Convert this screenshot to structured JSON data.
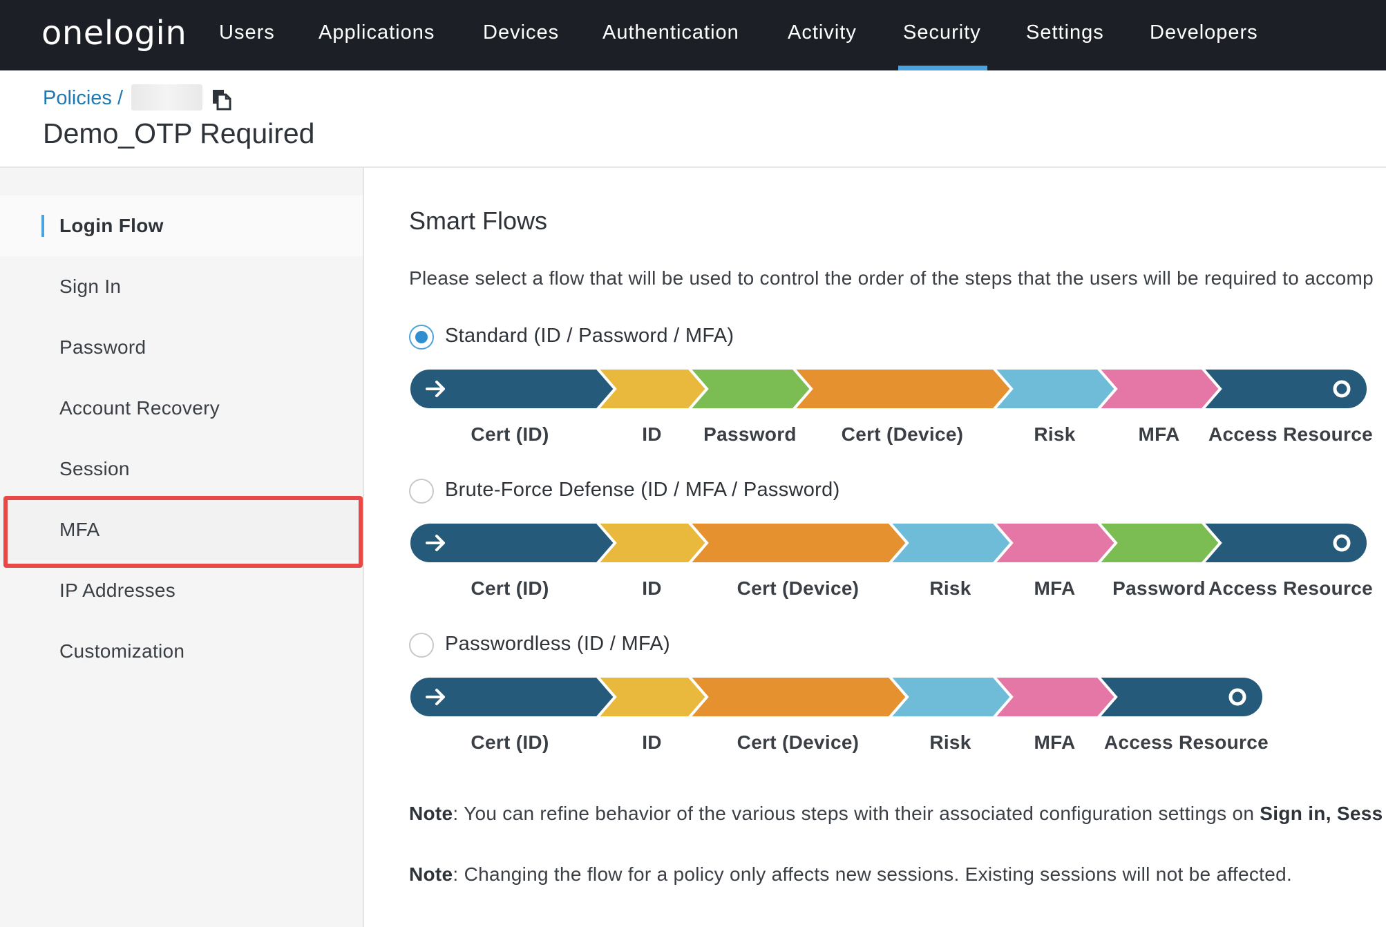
{
  "nav": {
    "logo": "onelogin",
    "items": [
      {
        "label": "Users"
      },
      {
        "label": "Applications"
      },
      {
        "label": "Devices"
      },
      {
        "label": "Authentication"
      },
      {
        "label": "Activity"
      },
      {
        "label": "Security",
        "active": true
      },
      {
        "label": "Settings"
      },
      {
        "label": "Developers"
      }
    ]
  },
  "header": {
    "breadcrumb_root": "Policies /",
    "title": "Demo_OTP Required"
  },
  "sidebar": {
    "items": [
      {
        "label": "Login Flow",
        "active": true
      },
      {
        "label": "Sign In"
      },
      {
        "label": "Password"
      },
      {
        "label": "Account Recovery"
      },
      {
        "label": "Session"
      },
      {
        "label": "MFA",
        "highlighted": true
      },
      {
        "label": "IP Addresses"
      },
      {
        "label": "Customization"
      }
    ]
  },
  "main": {
    "title": "Smart Flows",
    "description": "Please select a flow that will be used to control the order of the steps that the users will be required to accomp",
    "flows": [
      {
        "label": "Standard (ID / Password / MFA)",
        "selected": true,
        "steps": [
          "Cert (ID)",
          "ID",
          "Password",
          "Cert (Device)",
          "Risk",
          "MFA",
          "Access Resource"
        ]
      },
      {
        "label": "Brute-Force Defense (ID / MFA / Password)",
        "selected": false,
        "steps": [
          "Cert (ID)",
          "ID",
          "Cert (Device)",
          "Risk",
          "MFA",
          "Password",
          "Access Resource"
        ]
      },
      {
        "label": "Passwordless (ID / MFA)",
        "selected": false,
        "steps": [
          "Cert (ID)",
          "ID",
          "Cert (Device)",
          "Risk",
          "MFA",
          "Access Resource"
        ]
      }
    ],
    "note1_label": "Note",
    "note1_text": ": You can refine behavior of the various steps with their associated configuration settings on ",
    "note1_bold": "Sign in, Sess",
    "note2_label": "Note",
    "note2_text": ": Changing the flow for a policy only affects new sessions. Existing sessions will not be affected."
  },
  "colors": {
    "cert_id": "#265a7a",
    "id": "#e8b93c",
    "password": "#7bbd53",
    "cert_device": "#e5912f",
    "risk": "#6fbcd9",
    "mfa": "#e577a6",
    "access": "#265a7a",
    "accent": "#4aa3df",
    "highlight": "#e84846"
  }
}
